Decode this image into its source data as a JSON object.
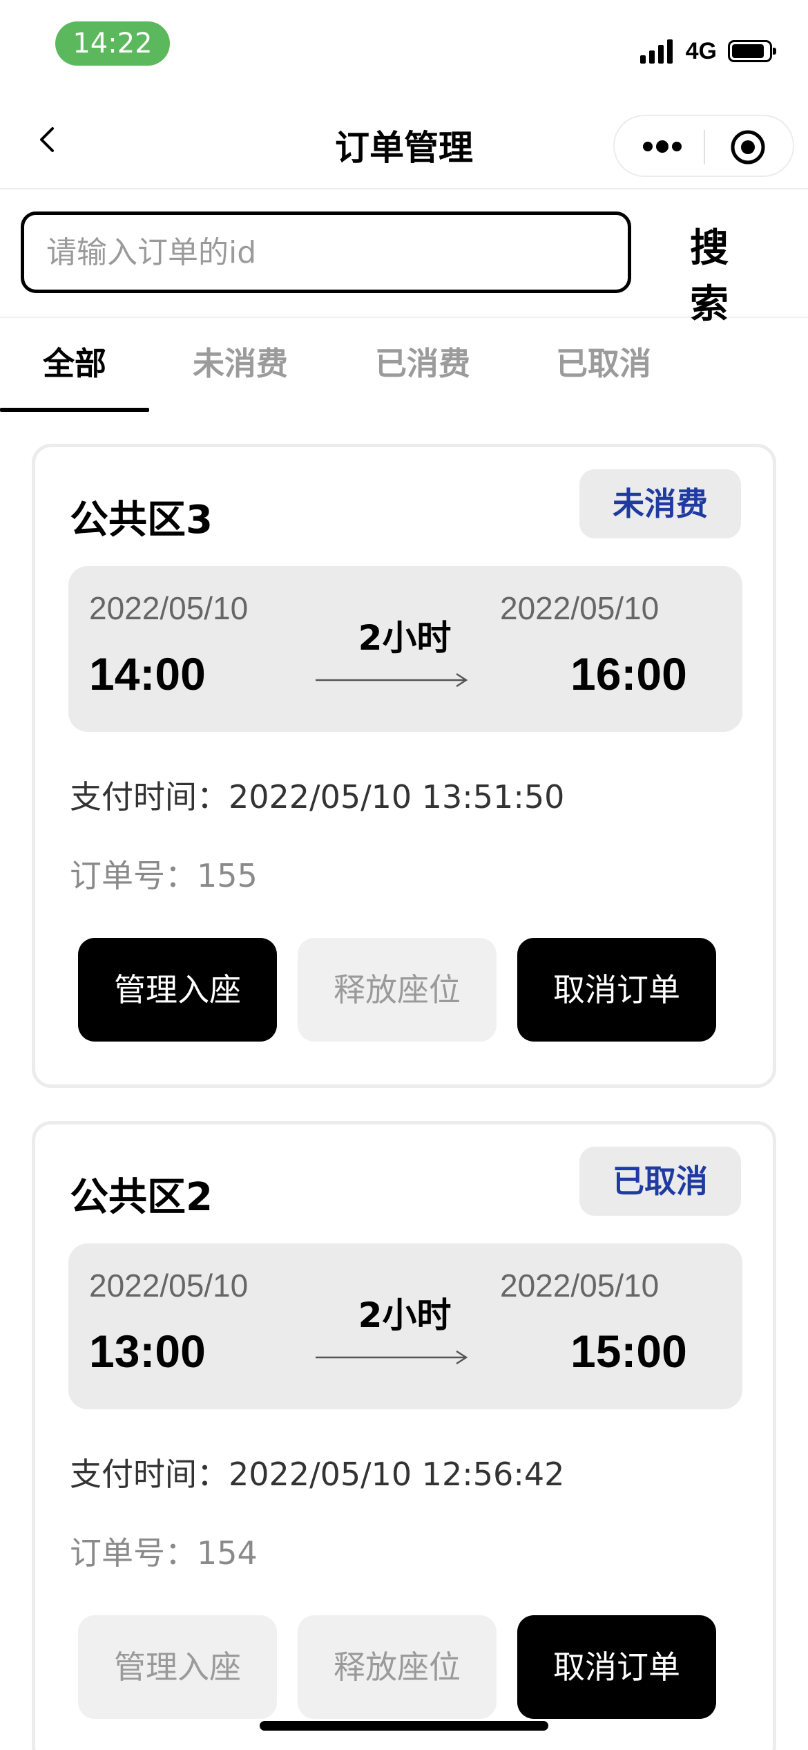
{
  "status_bar": {
    "time": "14:22",
    "network": "4G"
  },
  "nav": {
    "title": "订单管理"
  },
  "search": {
    "placeholder": "请输入订单的id",
    "value": "",
    "button_label": "搜 索"
  },
  "tabs": [
    {
      "label": "全部",
      "active": true
    },
    {
      "label": "未消费",
      "active": false
    },
    {
      "label": "已消费",
      "active": false
    },
    {
      "label": "已取消",
      "active": false
    }
  ],
  "orders": [
    {
      "area": "公共区3",
      "status": "未消费",
      "start_date": "2022/05/10",
      "start_time": "14:00",
      "duration": "2小时",
      "end_date": "2022/05/10",
      "end_time": "16:00",
      "pay_time": "支付时间：2022/05/10 13:51:50",
      "order_no": "订单号：155",
      "buttons": [
        {
          "label": "管理入座",
          "enabled": true
        },
        {
          "label": "释放座位",
          "enabled": false
        },
        {
          "label": "取消订单",
          "enabled": true
        }
      ]
    },
    {
      "area": "公共区2",
      "status": "已取消",
      "start_date": "2022/05/10",
      "start_time": "13:00",
      "duration": "2小时",
      "end_date": "2022/05/10",
      "end_time": "15:00",
      "pay_time": "支付时间：2022/05/10 12:56:42",
      "order_no": "订单号：154",
      "buttons": [
        {
          "label": "管理入座",
          "enabled": false
        },
        {
          "label": "释放座位",
          "enabled": false
        },
        {
          "label": "取消订单",
          "enabled": true
        }
      ]
    }
  ],
  "colors": {
    "status_pill": "#5cb85c",
    "badge_text": "#1f3aa0",
    "button_dark": "#000000",
    "button_disabled": "#f0f0f0",
    "time_box": "#ebebeb"
  },
  "icons": [
    "back-icon",
    "more-icon",
    "target-icon",
    "arrow-icon",
    "signal-icon",
    "battery-icon"
  ]
}
